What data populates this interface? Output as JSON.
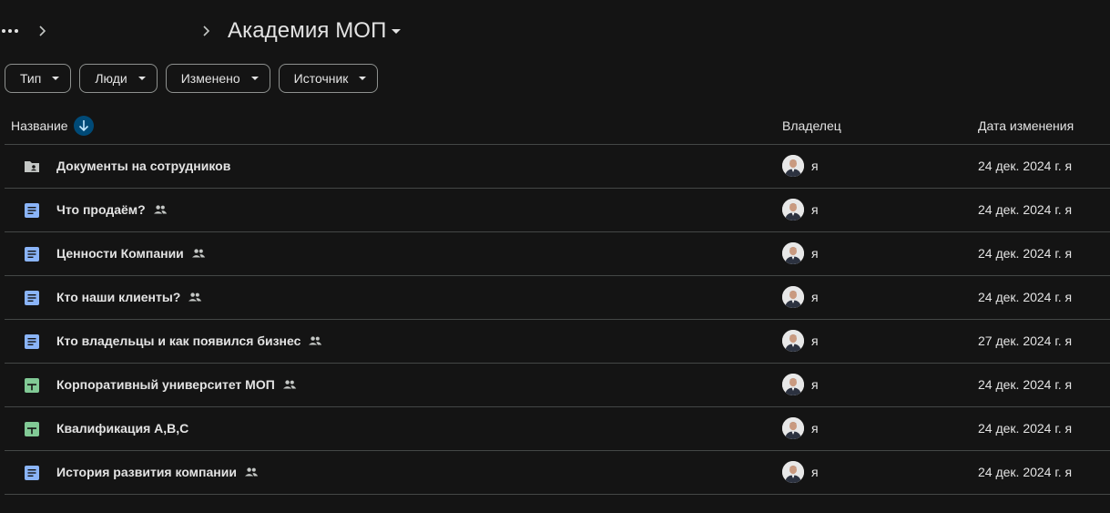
{
  "breadcrumb": {
    "more_icon": "more-horiz-icon",
    "separator_icon": "chevron-right-icon",
    "current_folder": "Академия МОП"
  },
  "filters": [
    {
      "label": "Тип"
    },
    {
      "label": "Люди"
    },
    {
      "label": "Изменено"
    },
    {
      "label": "Источник"
    }
  ],
  "table": {
    "columns": {
      "name": "Название",
      "owner": "Владелец",
      "modified": "Дата изменения"
    },
    "sort_icon": "arrow-downward-icon",
    "rows": [
      {
        "name": "Документы на сотрудников",
        "type": "shared-folder",
        "shared": false,
        "owner": "я",
        "modified": "24 дек. 2024 г. я"
      },
      {
        "name": "Что продаём?",
        "type": "doc",
        "shared": true,
        "owner": "я",
        "modified": "24 дек. 2024 г. я"
      },
      {
        "name": "Ценности Компании",
        "type": "doc",
        "shared": true,
        "owner": "я",
        "modified": "24 дек. 2024 г. я"
      },
      {
        "name": "Кто наши клиенты?",
        "type": "doc",
        "shared": true,
        "owner": "я",
        "modified": "24 дек. 2024 г. я"
      },
      {
        "name": "Кто владельцы и как появился бизнес",
        "type": "doc",
        "shared": true,
        "owner": "я",
        "modified": "27 дек. 2024 г. я"
      },
      {
        "name": "Корпоративный университет МОП",
        "type": "sheet",
        "shared": true,
        "owner": "я",
        "modified": "24 дек. 2024 г. я"
      },
      {
        "name": "Квалификация А,В,С",
        "type": "sheet",
        "shared": false,
        "owner": "я",
        "modified": "24 дек. 2024 г. я"
      },
      {
        "name": "История развития компании",
        "type": "doc",
        "shared": true,
        "owner": "я",
        "modified": "24 дек. 2024 г. я"
      }
    ]
  },
  "colors": {
    "background": "#141414",
    "doc_icon": "#8ab4f8",
    "sheet_icon": "#81c995",
    "sort_button": "#004a77",
    "divider": "#444746"
  }
}
